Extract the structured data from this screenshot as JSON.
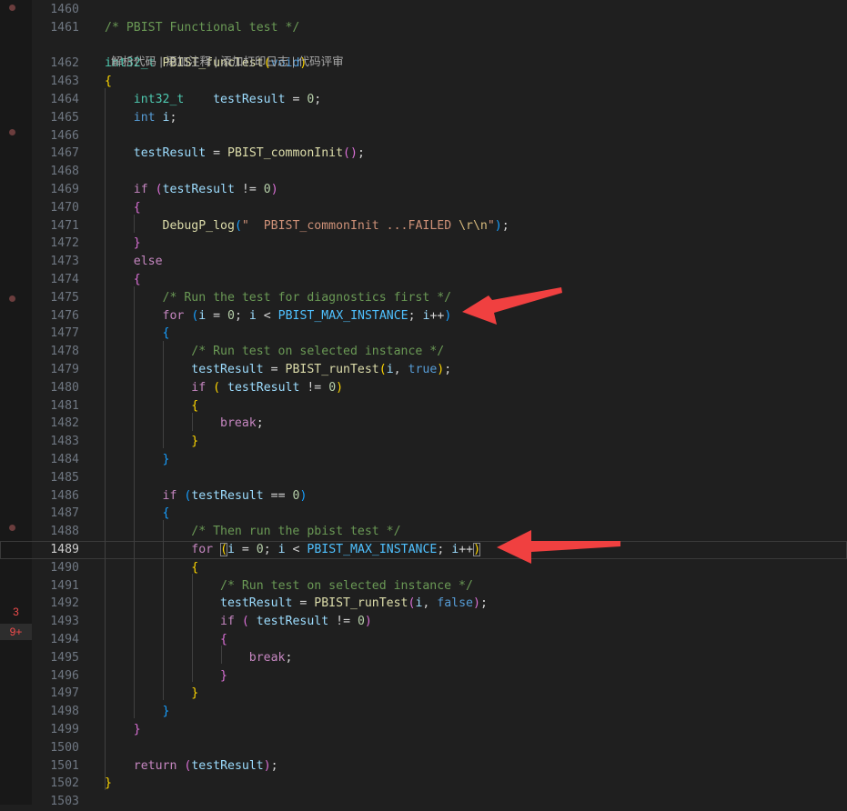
{
  "gutter": {
    "badges": [
      {
        "text": "3",
        "highlight": false
      },
      {
        "text": "9+",
        "highlight": true
      }
    ]
  },
  "codelens": {
    "items": [
      "解析代码",
      "添加注释",
      "添加打印日志",
      "代码评审"
    ],
    "separator": " | "
  },
  "current_line": 1489,
  "colors": {
    "background": "#1f1f1f",
    "comment": "#6a9955",
    "type": "#4ec9b0",
    "keyword": "#569cd6",
    "control": "#c586c0",
    "function": "#dcdcaa",
    "variable": "#9cdcfe",
    "number": "#b5cea8",
    "string": "#ce9178",
    "macro": "#4fc1ff",
    "bracket_level1": "#ffd700",
    "bracket_level2": "#da70d6",
    "bracket_level3": "#179fff",
    "annotation_arrow": "#f04040"
  },
  "lines": [
    {
      "num": "1460",
      "tokens": []
    },
    {
      "num": "1461",
      "tokens": [
        [
          "/* PBIST Functional test */",
          "cm"
        ]
      ]
    },
    {
      "num": "1462",
      "tokens": [
        [
          "int32_t",
          "ty"
        ],
        [
          " ",
          "tx"
        ],
        [
          "PBIST_funcTest",
          "fn"
        ],
        [
          "(",
          "b1"
        ],
        [
          "void",
          "kw"
        ],
        [
          ")",
          "b1"
        ]
      ]
    },
    {
      "num": "1463",
      "tokens": [
        [
          "{",
          "b1"
        ]
      ]
    },
    {
      "num": "1464",
      "tokens": [
        [
          "    ",
          "tx"
        ],
        [
          "int32_t",
          "ty"
        ],
        [
          "    ",
          "tx"
        ],
        [
          "testResult",
          "var"
        ],
        [
          " = ",
          "tx"
        ],
        [
          "0",
          "num"
        ],
        [
          ";",
          "tx"
        ]
      ]
    },
    {
      "num": "1465",
      "tokens": [
        [
          "    ",
          "tx"
        ],
        [
          "int",
          "kw"
        ],
        [
          " ",
          "tx"
        ],
        [
          "i",
          "var"
        ],
        [
          ";",
          "tx"
        ]
      ]
    },
    {
      "num": "1466",
      "tokens": []
    },
    {
      "num": "1467",
      "tokens": [
        [
          "    ",
          "tx"
        ],
        [
          "testResult",
          "var"
        ],
        [
          " = ",
          "tx"
        ],
        [
          "PBIST_commonInit",
          "fn"
        ],
        [
          "(",
          "b2"
        ],
        [
          ")",
          "b2"
        ],
        [
          ";",
          "tx"
        ]
      ]
    },
    {
      "num": "1468",
      "tokens": []
    },
    {
      "num": "1469",
      "tokens": [
        [
          "    ",
          "tx"
        ],
        [
          "if",
          "ctl"
        ],
        [
          " ",
          "tx"
        ],
        [
          "(",
          "b2"
        ],
        [
          "testResult",
          "var"
        ],
        [
          " != ",
          "tx"
        ],
        [
          "0",
          "num"
        ],
        [
          ")",
          "b2"
        ]
      ]
    },
    {
      "num": "1470",
      "tokens": [
        [
          "    ",
          "tx"
        ],
        [
          "{",
          "b2"
        ]
      ]
    },
    {
      "num": "1471",
      "tokens": [
        [
          "        ",
          "tx"
        ],
        [
          "DebugP_log",
          "fn"
        ],
        [
          "(",
          "b3"
        ],
        [
          "\"  PBIST_commonInit ...FAILED ",
          "str"
        ],
        [
          "\\r\\n",
          "esc"
        ],
        [
          "\"",
          "str"
        ],
        [
          ")",
          "b3"
        ],
        [
          ";",
          "tx"
        ]
      ]
    },
    {
      "num": "1472",
      "tokens": [
        [
          "    ",
          "tx"
        ],
        [
          "}",
          "b2"
        ]
      ]
    },
    {
      "num": "1473",
      "tokens": [
        [
          "    ",
          "tx"
        ],
        [
          "else",
          "ctl"
        ]
      ]
    },
    {
      "num": "1474",
      "tokens": [
        [
          "    ",
          "tx"
        ],
        [
          "{",
          "b2"
        ]
      ]
    },
    {
      "num": "1475",
      "tokens": [
        [
          "        ",
          "tx"
        ],
        [
          "/* Run the test for diagnostics first */",
          "cm"
        ]
      ]
    },
    {
      "num": "1476",
      "tokens": [
        [
          "        ",
          "tx"
        ],
        [
          "for",
          "ctl"
        ],
        [
          " ",
          "tx"
        ],
        [
          "(",
          "b3"
        ],
        [
          "i",
          "var"
        ],
        [
          " = ",
          "tx"
        ],
        [
          "0",
          "num"
        ],
        [
          "; ",
          "tx"
        ],
        [
          "i",
          "var"
        ],
        [
          " < ",
          "tx"
        ],
        [
          "PBIST_MAX_INSTANCE",
          "mac"
        ],
        [
          "; ",
          "tx"
        ],
        [
          "i",
          "var"
        ],
        [
          "++",
          "tx"
        ],
        [
          ")",
          "b3"
        ]
      ]
    },
    {
      "num": "1477",
      "tokens": [
        [
          "        ",
          "tx"
        ],
        [
          "{",
          "b3"
        ]
      ]
    },
    {
      "num": "1478",
      "tokens": [
        [
          "            ",
          "tx"
        ],
        [
          "/* Run test on selected instance */",
          "cm"
        ]
      ]
    },
    {
      "num": "1479",
      "tokens": [
        [
          "            ",
          "tx"
        ],
        [
          "testResult",
          "var"
        ],
        [
          " = ",
          "tx"
        ],
        [
          "PBIST_runTest",
          "fn"
        ],
        [
          "(",
          "b1"
        ],
        [
          "i",
          "var"
        ],
        [
          ", ",
          "tx"
        ],
        [
          "true",
          "kw"
        ],
        [
          ")",
          "b1"
        ],
        [
          ";",
          "tx"
        ]
      ]
    },
    {
      "num": "1480",
      "tokens": [
        [
          "            ",
          "tx"
        ],
        [
          "if",
          "ctl"
        ],
        [
          " ",
          "tx"
        ],
        [
          "(",
          "b1"
        ],
        [
          " testResult",
          "var"
        ],
        [
          " != ",
          "tx"
        ],
        [
          "0",
          "num"
        ],
        [
          ")",
          "b1"
        ]
      ]
    },
    {
      "num": "1481",
      "tokens": [
        [
          "            ",
          "tx"
        ],
        [
          "{",
          "b1"
        ]
      ]
    },
    {
      "num": "1482",
      "tokens": [
        [
          "                ",
          "tx"
        ],
        [
          "break",
          "ctl"
        ],
        [
          ";",
          "tx"
        ]
      ]
    },
    {
      "num": "1483",
      "tokens": [
        [
          "            ",
          "tx"
        ],
        [
          "}",
          "b1"
        ]
      ]
    },
    {
      "num": "1484",
      "tokens": [
        [
          "        ",
          "tx"
        ],
        [
          "}",
          "b3"
        ]
      ]
    },
    {
      "num": "1485",
      "tokens": []
    },
    {
      "num": "1486",
      "tokens": [
        [
          "        ",
          "tx"
        ],
        [
          "if",
          "ctl"
        ],
        [
          " ",
          "tx"
        ],
        [
          "(",
          "b3"
        ],
        [
          "testResult",
          "var"
        ],
        [
          " == ",
          "tx"
        ],
        [
          "0",
          "num"
        ],
        [
          ")",
          "b3"
        ]
      ]
    },
    {
      "num": "1487",
      "tokens": [
        [
          "        ",
          "tx"
        ],
        [
          "{",
          "b3"
        ]
      ]
    },
    {
      "num": "1488",
      "tokens": [
        [
          "            ",
          "tx"
        ],
        [
          "/* Then run the pbist test */",
          "cm"
        ]
      ]
    },
    {
      "num": "1489",
      "tokens": [
        [
          "            ",
          "tx"
        ],
        [
          "for",
          "ctl"
        ],
        [
          " ",
          "tx"
        ],
        [
          "(",
          "b1m"
        ],
        [
          "i",
          "var"
        ],
        [
          " = ",
          "tx"
        ],
        [
          "0",
          "num"
        ],
        [
          "; ",
          "tx"
        ],
        [
          "i",
          "var"
        ],
        [
          " < ",
          "tx"
        ],
        [
          "PBIST_MAX_INSTANCE",
          "mac"
        ],
        [
          "; ",
          "tx"
        ],
        [
          "i",
          "var"
        ],
        [
          "++",
          "tx"
        ],
        [
          ")",
          "b1m"
        ]
      ]
    },
    {
      "num": "1490",
      "tokens": [
        [
          "            ",
          "tx"
        ],
        [
          "{",
          "b1"
        ]
      ]
    },
    {
      "num": "1491",
      "tokens": [
        [
          "                ",
          "tx"
        ],
        [
          "/* Run test on selected instance */",
          "cm"
        ]
      ]
    },
    {
      "num": "1492",
      "tokens": [
        [
          "                ",
          "tx"
        ],
        [
          "testResult",
          "var"
        ],
        [
          " = ",
          "tx"
        ],
        [
          "PBIST_runTest",
          "fn"
        ],
        [
          "(",
          "b2"
        ],
        [
          "i",
          "var"
        ],
        [
          ", ",
          "tx"
        ],
        [
          "false",
          "kw"
        ],
        [
          ")",
          "b2"
        ],
        [
          ";",
          "tx"
        ]
      ]
    },
    {
      "num": "1493",
      "tokens": [
        [
          "                ",
          "tx"
        ],
        [
          "if",
          "ctl"
        ],
        [
          " ",
          "tx"
        ],
        [
          "(",
          "b2"
        ],
        [
          " testResult",
          "var"
        ],
        [
          " != ",
          "tx"
        ],
        [
          "0",
          "num"
        ],
        [
          ")",
          "b2"
        ]
      ]
    },
    {
      "num": "1494",
      "tokens": [
        [
          "                ",
          "tx"
        ],
        [
          "{",
          "b2"
        ]
      ]
    },
    {
      "num": "1495",
      "tokens": [
        [
          "                    ",
          "tx"
        ],
        [
          "break",
          "ctl"
        ],
        [
          ";",
          "tx"
        ]
      ]
    },
    {
      "num": "1496",
      "tokens": [
        [
          "                ",
          "tx"
        ],
        [
          "}",
          "b2"
        ]
      ]
    },
    {
      "num": "1497",
      "tokens": [
        [
          "            ",
          "tx"
        ],
        [
          "}",
          "b1"
        ]
      ]
    },
    {
      "num": "1498",
      "tokens": [
        [
          "        ",
          "tx"
        ],
        [
          "}",
          "b3"
        ]
      ]
    },
    {
      "num": "1499",
      "tokens": [
        [
          "    ",
          "tx"
        ],
        [
          "}",
          "b2"
        ]
      ]
    },
    {
      "num": "1500",
      "tokens": []
    },
    {
      "num": "1501",
      "tokens": [
        [
          "    ",
          "tx"
        ],
        [
          "return",
          "ctl"
        ],
        [
          " ",
          "tx"
        ],
        [
          "(",
          "b2"
        ],
        [
          "testResult",
          "var"
        ],
        [
          ")",
          "b2"
        ],
        [
          ";",
          "tx"
        ]
      ]
    },
    {
      "num": "1502",
      "tokens": [
        [
          "}",
          "b1"
        ]
      ]
    },
    {
      "num": "1503",
      "tokens": []
    }
  ]
}
